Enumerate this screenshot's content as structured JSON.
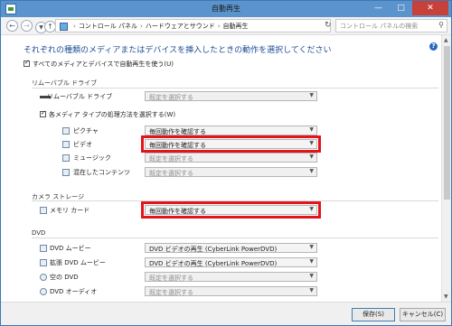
{
  "window": {
    "title": "自動再生"
  },
  "address": {
    "crumbs": [
      "コントロール パネル",
      "ハードウェアとサウンド",
      "自動再生"
    ],
    "search_placeholder": "コントロール パネルの検索"
  },
  "main": {
    "heading": "それぞれの種類のメディアまたはデバイスを挿入したときの動作を選択してください",
    "use_autoplay_label": "すべてのメディアとデバイスで自動再生を使う(U)",
    "removable": {
      "section": "リムーバブル ドライブ",
      "drive_label": "リムーバブル ドライブ",
      "drive_value": "既定を選択する",
      "per_type_label": "各メディア タイプの処理方法を選択する(W)",
      "items": [
        {
          "label": "ピクチャ",
          "value": "毎回動作を確認する"
        },
        {
          "label": "ビデオ",
          "value": "毎回動作を確認する"
        },
        {
          "label": "ミュージック",
          "value": "既定を選択する"
        },
        {
          "label": "混在したコンテンツ",
          "value": "既定を選択する"
        }
      ]
    },
    "camera": {
      "section": "カメラ ストレージ",
      "memory_label": "メモリ カード",
      "memory_value": "毎回動作を確認する"
    },
    "dvd": {
      "section": "DVD",
      "items": [
        {
          "label": "DVD ムービー",
          "value": "DVD ビデオの再生 (CyberLink PowerDVD)"
        },
        {
          "label": "拡張 DVD ムービー",
          "value": "DVD ビデオの再生 (CyberLink PowerDVD)"
        },
        {
          "label": "空の DVD",
          "value": "既定を選択する"
        },
        {
          "label": "DVD オーディオ",
          "value": "既定を選択する"
        }
      ]
    }
  },
  "footer": {
    "save": "保存(S)",
    "cancel": "キャンセル(C)"
  },
  "colors": {
    "highlight": "#e3141b",
    "heading": "#1e4e94",
    "titlebar": "#5b93cc"
  }
}
